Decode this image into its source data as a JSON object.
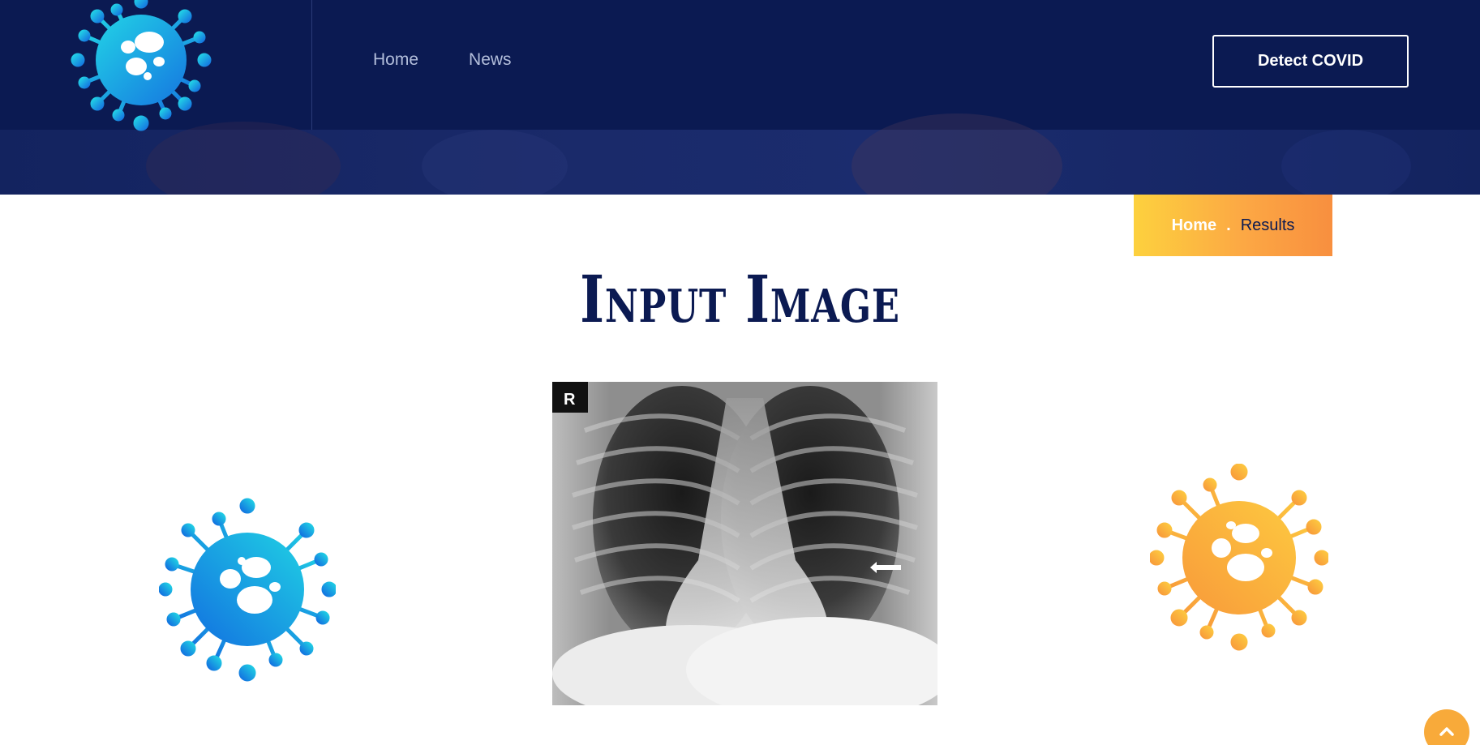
{
  "header": {
    "logo_icon": "virus-icon",
    "nav": [
      {
        "label": "Home"
      },
      {
        "label": "News"
      }
    ],
    "cta_label": "Detect COVID"
  },
  "breadcrumb": {
    "home": "Home",
    "separator": ".",
    "current": "Results"
  },
  "main": {
    "title": "Input Image",
    "xray_marker": "R"
  },
  "decor": {
    "left_icon": "virus-icon",
    "right_icon": "virus-icon"
  },
  "colors": {
    "navy": "#0b1a52",
    "cyan": "#1ecbe1",
    "blue": "#1270e0",
    "orange": "#f8a33a",
    "yellow": "#fdd13e"
  },
  "scroll_top_icon": "chevron-up-icon"
}
